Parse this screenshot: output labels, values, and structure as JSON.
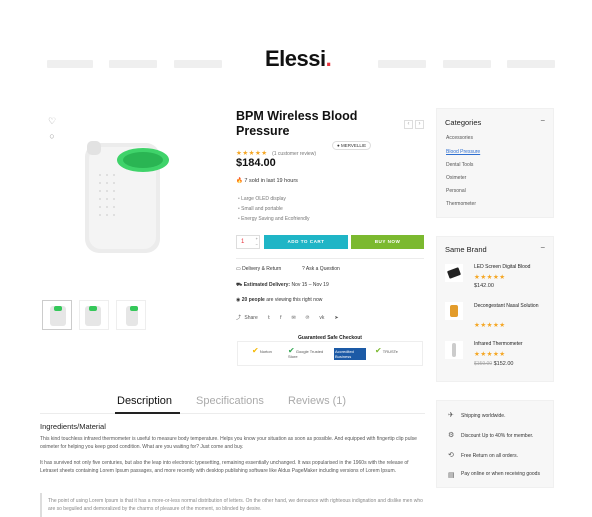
{
  "brand": {
    "name": "Elessi",
    "dot": "."
  },
  "product": {
    "title": "BPM Wireless Blood Pressure",
    "rating_stars": 5,
    "review_text": "(1 customer review)",
    "vendor": "MERVELLIE",
    "price": "$184.00",
    "sold_text": "7 sold in last 19 hours",
    "features": [
      "Large OLED display",
      "Small and portable",
      "Energy Saving and Ecofriendly"
    ],
    "qty": "1",
    "add_to_cart": "ADD TO CART",
    "buy_now": "BUY NOW",
    "delivery_return": "Delivery & Return",
    "ask_question": "Ask a Question",
    "estimated_label": "Estimated Delivery:",
    "estimated_value": "Nov 15 – Nov 19",
    "viewing_count": "20 people",
    "viewing_text": "are viewing this right now",
    "share_label": "Share",
    "checkout_title": "Guaranteed Safe Checkout",
    "badges": [
      "Norton",
      "Google Trusted Store",
      "Accredited Business",
      "TRUSTe"
    ]
  },
  "tabs": [
    "Description",
    "Specifications",
    "Reviews (1)"
  ],
  "description": {
    "heading": "Ingredients/Material",
    "p1": "This kind touchless infrared thermometer is useful to measure body temperature. Helps you know your situation as soon as possible. And equipped with fingertip clip pulse oximeter for helping you keep good condition. What are you waiting for? Just come and buy.",
    "p2": "It has survived not only five centuries, but also the leap into electronic typesetting, remaining essentially unchanged. It was popularised in the 1960s with the release of Letraset sheets containing Lorem Ipsum passages, and more recently with desktop publishing software like Aldus PageMaker including versions of Lorem Ipsum.",
    "quote": "The point of using Lorem Ipsum is that it has a more-or-less normal distribution of letters. On the other hand, we denounce with righteous indignation and dislike men who are so beguiled and demoralized by the charms of pleasure of the moment, so blinded by desire."
  },
  "categories": {
    "title": "Categories",
    "items": [
      "Accessories",
      "Blood Pressure",
      "Dental Tools",
      "Oximeter",
      "Personal",
      "Thermometer"
    ],
    "active": "Blood Pressure"
  },
  "same_brand": {
    "title": "Same Brand",
    "items": [
      {
        "name": "LED Screen Digital Blood",
        "price": "$142.00",
        "old": ""
      },
      {
        "name": "Decongestant Nasal Solution",
        "price": "",
        "old": ""
      },
      {
        "name": "Infrared Thermometer",
        "price": "$152.00",
        "old": "$159.00"
      }
    ]
  },
  "shipping": [
    "Shipping worldwide.",
    "Discount Up to 40% for member.",
    "Free Return on all orders.",
    "Pay online or when receiving goods"
  ],
  "colors": {
    "accent": "#1fb5c6",
    "buy": "#7bb92f",
    "star": "#f5a623",
    "brand_dot": "#e8343e",
    "link": "#2f6fd0"
  }
}
